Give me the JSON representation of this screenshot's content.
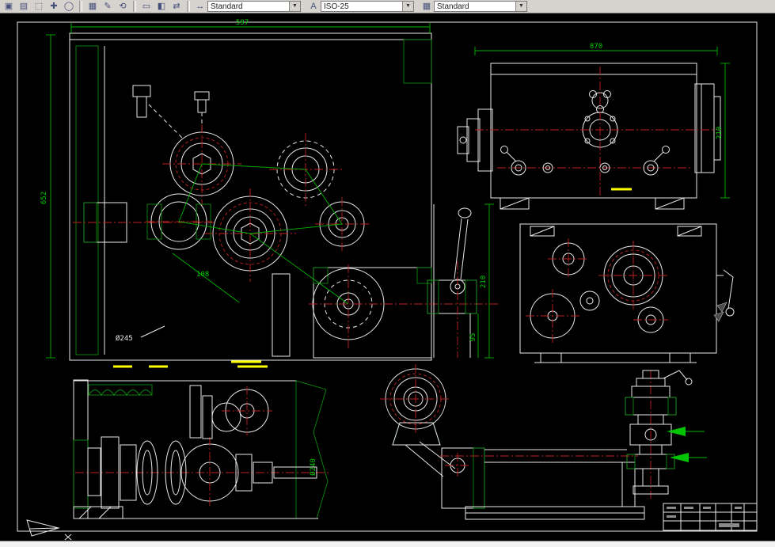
{
  "toolbar": {
    "icons": [
      "▣",
      "▤",
      "⬚",
      "✚",
      "◯",
      "▦",
      "✎",
      "⟲",
      "▭",
      "◧",
      "⇄"
    ],
    "combos": [
      {
        "label": "dim-style",
        "icon": "↔",
        "value": "Standard"
      },
      {
        "label": "text-style",
        "icon": "A",
        "value": "ISO-25"
      },
      {
        "label": "table-style",
        "icon": "▦",
        "value": "Standard"
      }
    ],
    "combo_arrow": "▼"
  },
  "drawing": {
    "dims": {
      "w597": "597",
      "w870": "870",
      "h652": "652",
      "h210_side": "210",
      "h210_lever": "210",
      "h95": "95",
      "a108": "108",
      "d245": "Ø245",
      "d240": "Ø240"
    },
    "colors": {
      "line": "#e9e9e9",
      "dimension": "#00b400",
      "centerline": "#c02020",
      "highlight": "#ffff00",
      "background": "#000000"
    }
  }
}
